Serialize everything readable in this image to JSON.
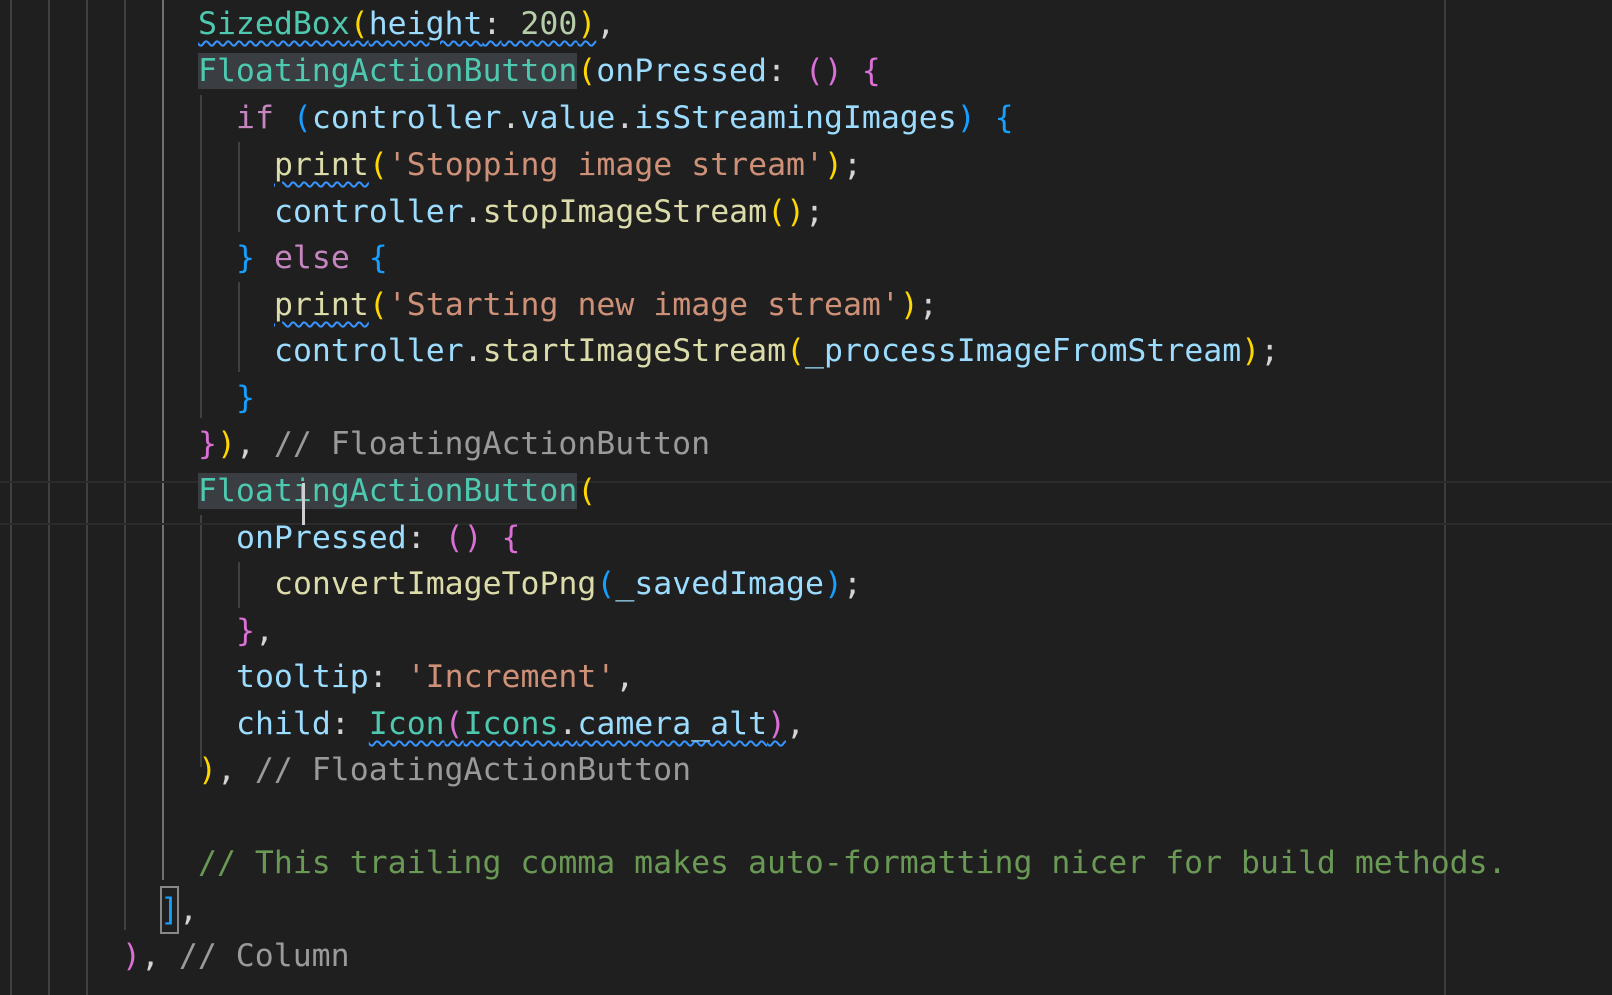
{
  "editor": {
    "language": "dart",
    "theme_colors": {
      "background": "#1f1f1f",
      "class": "#4ec9b0",
      "property": "#9cdcfe",
      "string": "#ce9178",
      "keyword": "#c586c0",
      "function": "#dcdcaa",
      "comment": "#6a9955"
    },
    "lines": [
      {
        "tokens": [
          "SizedBox",
          "(",
          "height",
          ":",
          " 200",
          ")",
          ","
        ]
      },
      {
        "tokens": [
          "FloatingActionButton",
          "(",
          "onPressed",
          ":",
          " ",
          "()",
          " ",
          "{"
        ]
      },
      {
        "tokens": [
          "if",
          " ",
          "(",
          "controller",
          ".",
          "value",
          ".",
          "isStreamingImages",
          ")",
          " ",
          "{"
        ]
      },
      {
        "tokens": [
          "print",
          "(",
          "'Stopping image stream'",
          ")",
          ";"
        ]
      },
      {
        "tokens": [
          "controller",
          ".",
          "stopImageStream",
          "()",
          ";"
        ]
      },
      {
        "tokens": [
          "}",
          " ",
          "else",
          " ",
          "{"
        ]
      },
      {
        "tokens": [
          "print",
          "(",
          "'Starting new image stream'",
          ")",
          ";"
        ]
      },
      {
        "tokens": [
          "controller",
          ".",
          "startImageStream",
          "(",
          "_processImageFromStream",
          ")",
          ";"
        ]
      },
      {
        "tokens": [
          "}"
        ]
      },
      {
        "tokens": [
          "}",
          ")",
          ",",
          " // FloatingActionButton"
        ]
      },
      {
        "tokens": [
          "FloatingActionButton",
          "("
        ]
      },
      {
        "tokens": [
          "onPressed",
          ":",
          " ",
          "()",
          " ",
          "{"
        ]
      },
      {
        "tokens": [
          "convertImageToPng",
          "(",
          "_savedImage",
          ")",
          ";"
        ]
      },
      {
        "tokens": [
          "}",
          ","
        ]
      },
      {
        "tokens": [
          "tooltip",
          ":",
          " ",
          "'Increment'",
          ","
        ]
      },
      {
        "tokens": [
          "child",
          ":",
          " ",
          "Icon",
          "(",
          "Icons",
          ".",
          "camera_alt",
          ")",
          ","
        ]
      },
      {
        "tokens": [
          ")",
          ",",
          " // FloatingActionButton"
        ]
      },
      {
        "tokens": []
      },
      {
        "tokens": [
          "// This trailing comma makes auto-formatting nicer for build methods."
        ]
      },
      {
        "tokens": [
          "]",
          ","
        ]
      },
      {
        "tokens": [
          ")",
          ",",
          " // Column"
        ]
      }
    ]
  }
}
